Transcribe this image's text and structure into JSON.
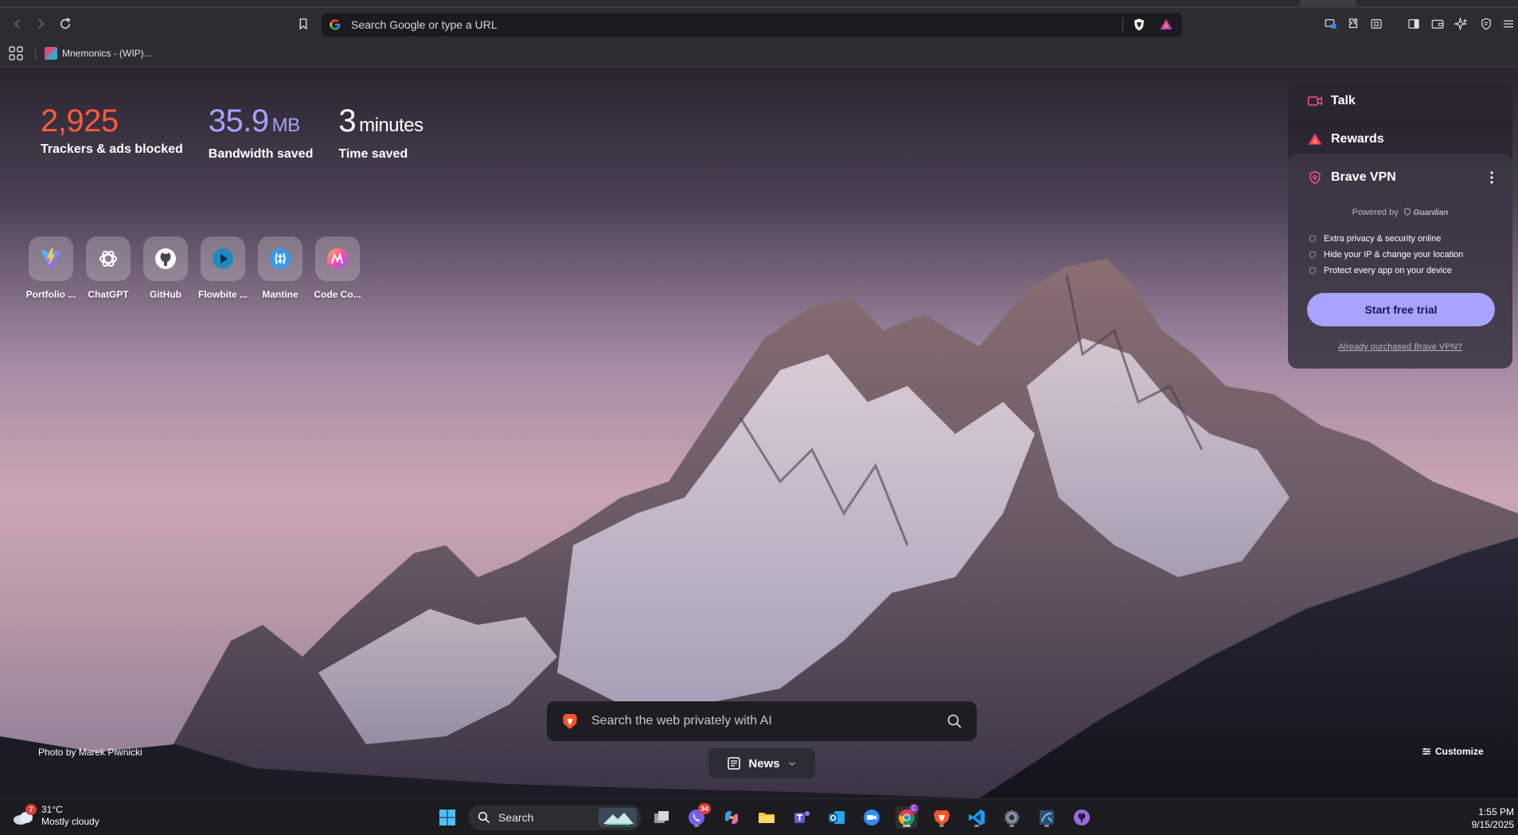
{
  "toolbar": {
    "url_placeholder": "Search Google or type a URL"
  },
  "bookmarks": {
    "items": [
      {
        "label": "Mnemonics - (WIP)..."
      }
    ]
  },
  "stats": {
    "trackers": {
      "value": "2,925",
      "label": "Trackers & ads blocked"
    },
    "bandwidth": {
      "value": "35.9",
      "unit": "MB",
      "label": "Bandwidth saved"
    },
    "time": {
      "value": "3",
      "unit": "minutes",
      "label": "Time saved"
    }
  },
  "top_sites": [
    {
      "name": "Portfolio ...",
      "icon": "vite-icon"
    },
    {
      "name": "ChatGPT",
      "icon": "chatgpt-icon"
    },
    {
      "name": "GitHub",
      "icon": "github-icon"
    },
    {
      "name": "Flowbite ...",
      "icon": "flowbite-icon"
    },
    {
      "name": "Mantine",
      "icon": "mantine-icon"
    },
    {
      "name": "Code Co...",
      "icon": "code-co-icon"
    }
  ],
  "cards": {
    "talk": "Talk",
    "rewards": "Rewards",
    "vpn": {
      "title": "Brave VPN",
      "powered_by": "Powered by",
      "powered_brand": "Guardian",
      "features": [
        "Extra privacy & security online",
        "Hide your IP & change your location",
        "Protect every app on your device"
      ],
      "cta": "Start free trial",
      "purchased_link": "Already purchased Brave VPN?"
    }
  },
  "photo_credit": "Photo by Marek Piwnicki",
  "customize": "Customize",
  "search_ai": {
    "placeholder": "Search the web privately with AI"
  },
  "news": "News",
  "taskbar": {
    "weather": {
      "badge": "7",
      "temp": "31°C",
      "condition": "Mostly cloudy"
    },
    "search_label": "Search",
    "phone_badge": "34",
    "chrome_badge": "C",
    "time": "1:55 PM",
    "date": "9/15/2025"
  },
  "colors": {
    "trackers": "#ff5a3d",
    "bandwidth": "#a6a2ff",
    "cta": "#a8a3ff",
    "brave_orange": "#fb542b"
  }
}
